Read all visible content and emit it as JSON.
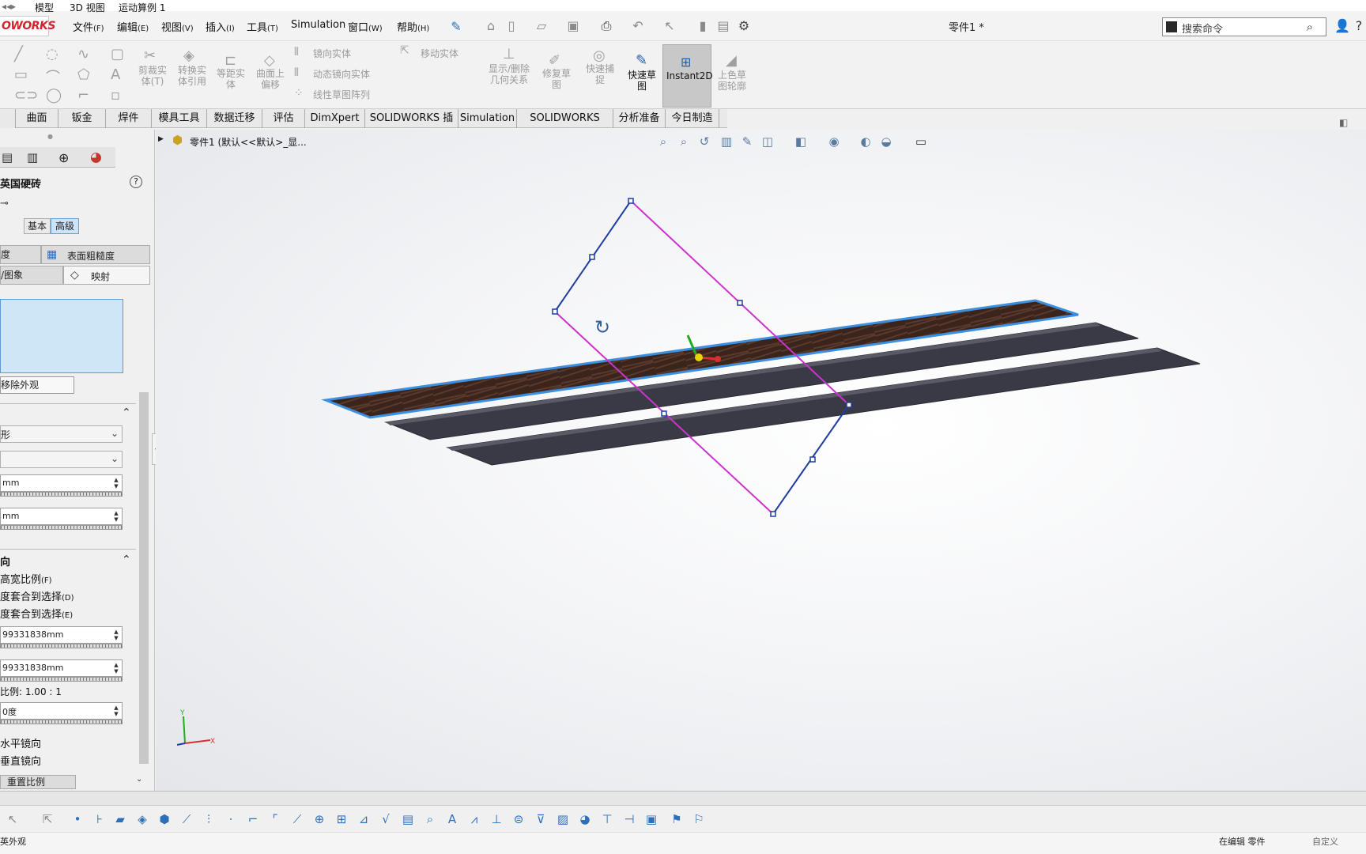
{
  "app": {
    "logo": "OWORKS",
    "doc_title": "零件1 *",
    "search_placeholder": "搜索命令"
  },
  "menus": [
    {
      "label": "文件",
      "key": "(F)"
    },
    {
      "label": "编辑",
      "key": "(E)"
    },
    {
      "label": "视图",
      "key": "(V)"
    },
    {
      "label": "插入",
      "key": "(I)"
    },
    {
      "label": "工具",
      "key": "(T)"
    },
    {
      "label": "Simulation",
      "key": ""
    },
    {
      "label": "窗口",
      "key": "(W)"
    },
    {
      "label": "帮助",
      "key": "(H)"
    }
  ],
  "ribbon": {
    "trim_entities": "剪裁实体(T)",
    "convert_entities": "转换实体引用",
    "offset_entities": "等距实体",
    "offset_on_surface": "曲面上偏移",
    "mirror_entities": "镜向实体",
    "dynamic_mirror": "动态镜向实体",
    "linear_pattern": "线性草图阵列",
    "move_entities": "移动实体",
    "show_delete_relations": "显示/删除几何关系",
    "repair_sketch": "修复草图",
    "quick_snaps": "快速捕捉",
    "rapid_sketch": "快速草图",
    "instant2d": "Instant2D",
    "shaded_sketch_contours": "上色草图轮廓"
  },
  "tabs": [
    "曲面",
    "钣金",
    "焊件",
    "模具工具",
    "数据迁移",
    "评估",
    "DimXpert",
    "SOLIDWORKS 插件",
    "Simulation",
    "SOLIDWORKS MBD",
    "分析准备",
    "今日制造"
  ],
  "left_panel": {
    "title": "英国硬砖",
    "mode_basic": "基本",
    "mode_advanced": "高级",
    "tab_illumination": "度",
    "tab_surface_finish": "表面粗糙度",
    "tab_color_image": "/图象",
    "tab_mapping": "映射",
    "remove_appearance": "移除外观",
    "width_value": "mm",
    "height_value": "mm",
    "direction_header": "向",
    "fixed_aspect": "高宽比例",
    "fixed_aspect_key": "(F)",
    "fit_width": "度套合到选择",
    "fit_width_key": "(D)",
    "fit_height": "度套合到选择",
    "fit_height_key": "(E)",
    "width_field": "99331838mm",
    "height_field": "99331838mm",
    "ratio_label": "比例: 1.00 : 1",
    "angle_field": "0度",
    "mirror_horizontal": "水平镜向",
    "mirror_vertical": "垂直镜向",
    "reset_scale": "重置比例"
  },
  "viewport": {
    "breadcrumb": "零件1  (默认<<默认>_显..."
  },
  "bottom_tabs": [
    "模型",
    "3D 视图",
    "运动算例 1"
  ],
  "status": {
    "left": "英外观",
    "editing": "在编辑 零件",
    "custom": "自定义"
  },
  "colors": {
    "brand_red": "#d2232a",
    "plane_edge": "#cc33cc",
    "plane_edge_blue": "#1f3d9e",
    "highlight_blue": "#3d8fe0",
    "plank_dark": "#3a3a46",
    "wood_texture": "#3a241c"
  }
}
